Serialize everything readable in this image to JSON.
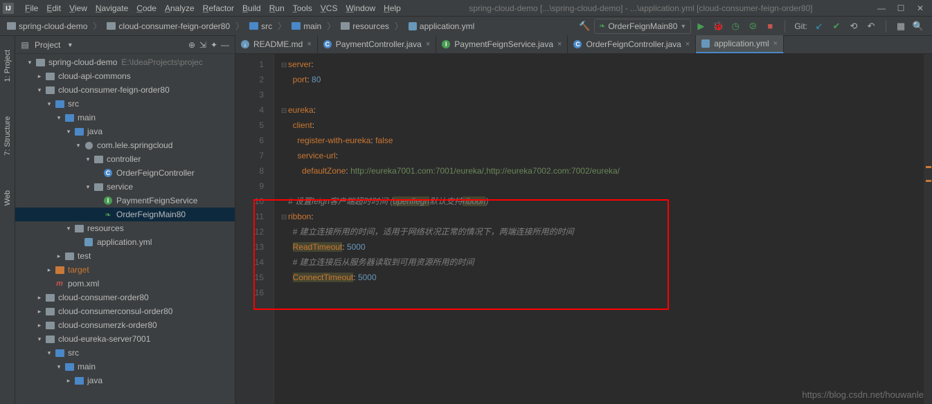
{
  "menu": {
    "items": [
      "File",
      "Edit",
      "View",
      "Navigate",
      "Code",
      "Analyze",
      "Refactor",
      "Build",
      "Run",
      "Tools",
      "VCS",
      "Window",
      "Help"
    ]
  },
  "windowTitle": "spring-cloud-demo [...\\spring-cloud-demo] - ...\\application.yml [cloud-consumer-feign-order80]",
  "breadcrumb": [
    {
      "icon": "folder",
      "label": "spring-cloud-demo"
    },
    {
      "icon": "folder",
      "label": "cloud-consumer-feign-order80"
    },
    {
      "icon": "folder-blue",
      "label": "src"
    },
    {
      "icon": "folder-blue",
      "label": "main"
    },
    {
      "icon": "folder",
      "label": "resources"
    },
    {
      "icon": "yml",
      "label": "application.yml"
    }
  ],
  "runConfig": "OrderFeignMain80",
  "gitLabel": "Git:",
  "projectPanel": {
    "title": "Project"
  },
  "leftTools": [
    "1: Project",
    "7: Structure",
    "Web"
  ],
  "tree": [
    {
      "depth": 1,
      "arrow": "▾",
      "icon": "folder",
      "label": "spring-cloud-demo",
      "hint": "E:\\IdeaProjects\\projec"
    },
    {
      "depth": 2,
      "arrow": "▸",
      "icon": "folder",
      "label": "cloud-api-commons"
    },
    {
      "depth": 2,
      "arrow": "▾",
      "icon": "folder",
      "label": "cloud-consumer-feign-order80"
    },
    {
      "depth": 3,
      "arrow": "▾",
      "icon": "folder-blue",
      "label": "src"
    },
    {
      "depth": 4,
      "arrow": "▾",
      "icon": "folder-blue",
      "label": "main"
    },
    {
      "depth": 5,
      "arrow": "▾",
      "icon": "folder-blue",
      "label": "java"
    },
    {
      "depth": 6,
      "arrow": "▾",
      "icon": "pkg",
      "label": "com.lele.springcloud"
    },
    {
      "depth": 7,
      "arrow": "▾",
      "icon": "folder",
      "label": "controller"
    },
    {
      "depth": 8,
      "arrow": "",
      "icon": "class-c",
      "label": "OrderFeignController"
    },
    {
      "depth": 7,
      "arrow": "▾",
      "icon": "folder",
      "label": "service"
    },
    {
      "depth": 8,
      "arrow": "",
      "icon": "class-i",
      "label": "PaymentFeignService"
    },
    {
      "depth": 8,
      "arrow": "",
      "icon": "leaf",
      "label": "OrderFeignMain80",
      "selected": true
    },
    {
      "depth": 5,
      "arrow": "▾",
      "icon": "folder",
      "label": "resources"
    },
    {
      "depth": 6,
      "arrow": "",
      "icon": "yml",
      "label": "application.yml"
    },
    {
      "depth": 4,
      "arrow": "▸",
      "icon": "folder",
      "label": "test"
    },
    {
      "depth": 3,
      "arrow": "▸",
      "icon": "folder-orange",
      "label": "target",
      "orange": true
    },
    {
      "depth": 3,
      "arrow": "",
      "icon": "maven",
      "label": "pom.xml"
    },
    {
      "depth": 2,
      "arrow": "▸",
      "icon": "folder",
      "label": "cloud-consumer-order80"
    },
    {
      "depth": 2,
      "arrow": "▸",
      "icon": "folder",
      "label": "cloud-consumerconsul-order80"
    },
    {
      "depth": 2,
      "arrow": "▸",
      "icon": "folder",
      "label": "cloud-consumerzk-order80"
    },
    {
      "depth": 2,
      "arrow": "▾",
      "icon": "folder",
      "label": "cloud-eureka-server7001"
    },
    {
      "depth": 3,
      "arrow": "▾",
      "icon": "folder-blue",
      "label": "src"
    },
    {
      "depth": 4,
      "arrow": "▾",
      "icon": "folder-blue",
      "label": "main"
    },
    {
      "depth": 5,
      "arrow": "▸",
      "icon": "folder-blue",
      "label": "java"
    }
  ],
  "editorTabs": [
    {
      "icon": "md",
      "label": "README.md",
      "active": false
    },
    {
      "icon": "class-c",
      "label": "PaymentController.java",
      "active": false
    },
    {
      "icon": "class-i",
      "label": "PaymentFeignService.java",
      "active": false
    },
    {
      "icon": "class-c",
      "label": "OrderFeignController.java",
      "active": false
    },
    {
      "icon": "yml",
      "label": "application.yml",
      "active": true
    }
  ],
  "code": {
    "lines": [
      {
        "n": 1,
        "segs": [
          {
            "t": "server",
            "c": "kw"
          },
          {
            "t": ":",
            "c": ""
          }
        ]
      },
      {
        "n": 2,
        "segs": [
          {
            "t": "  ",
            "c": ""
          },
          {
            "t": "port",
            "c": "kw"
          },
          {
            "t": ": ",
            "c": ""
          },
          {
            "t": "80",
            "c": "num"
          }
        ]
      },
      {
        "n": 3,
        "segs": []
      },
      {
        "n": 4,
        "segs": [
          {
            "t": "eureka",
            "c": "kw"
          },
          {
            "t": ":",
            "c": ""
          }
        ]
      },
      {
        "n": 5,
        "segs": [
          {
            "t": "  ",
            "c": ""
          },
          {
            "t": "client",
            "c": "kw"
          },
          {
            "t": ":",
            "c": ""
          }
        ]
      },
      {
        "n": 6,
        "segs": [
          {
            "t": "    ",
            "c": ""
          },
          {
            "t": "register-with-eureka",
            "c": "kw"
          },
          {
            "t": ": ",
            "c": ""
          },
          {
            "t": "false",
            "c": "kw"
          }
        ]
      },
      {
        "n": 7,
        "segs": [
          {
            "t": "    ",
            "c": ""
          },
          {
            "t": "service-url",
            "c": "kw"
          },
          {
            "t": ":",
            "c": ""
          }
        ]
      },
      {
        "n": 8,
        "segs": [
          {
            "t": "      ",
            "c": ""
          },
          {
            "t": "defaultZone",
            "c": "kw"
          },
          {
            "t": ": ",
            "c": ""
          },
          {
            "t": "http://eureka7001.com:7001/eureka/,http://eureka7002.com:7002/eureka/",
            "c": "str"
          }
        ]
      },
      {
        "n": 9,
        "segs": []
      },
      {
        "n": 10,
        "segs": [
          {
            "t": "# 设置",
            "c": "cmt"
          },
          {
            "t": "feign",
            "c": "cmt cmt-it"
          },
          {
            "t": "客户端超时时间 (",
            "c": "cmt"
          },
          {
            "t": "openfiegn",
            "c": "cmt cmt-it word-warn"
          },
          {
            "t": "默认支持",
            "c": "cmt"
          },
          {
            "t": "riboon",
            "c": "cmt cmt-it word-warn"
          },
          {
            "t": ")",
            "c": "cmt"
          }
        ]
      },
      {
        "n": 11,
        "segs": [
          {
            "t": "ribbon",
            "c": "kw"
          },
          {
            "t": ":",
            "c": ""
          }
        ]
      },
      {
        "n": 12,
        "segs": [
          {
            "t": "  # 建立连接所用的时间，适用于网络状况正常的情况下，两端连接所用的时间",
            "c": "cmt"
          }
        ]
      },
      {
        "n": 13,
        "segs": [
          {
            "t": "  ",
            "c": ""
          },
          {
            "t": "ReadTimeout",
            "c": "kw word-warn"
          },
          {
            "t": ": ",
            "c": ""
          },
          {
            "t": "5000",
            "c": "num"
          }
        ]
      },
      {
        "n": 14,
        "segs": [
          {
            "t": "  # 建立连接后从服务器读取到可用资源所用的时间",
            "c": "cmt"
          }
        ]
      },
      {
        "n": 15,
        "segs": [
          {
            "t": "  ",
            "c": ""
          },
          {
            "t": "ConnectTimeout",
            "c": "kw word-warn"
          },
          {
            "t": ": ",
            "c": ""
          },
          {
            "t": "5000",
            "c": "num"
          }
        ]
      },
      {
        "n": 16,
        "segs": []
      }
    ]
  },
  "watermark": "https://blog.csdn.net/houwanle"
}
